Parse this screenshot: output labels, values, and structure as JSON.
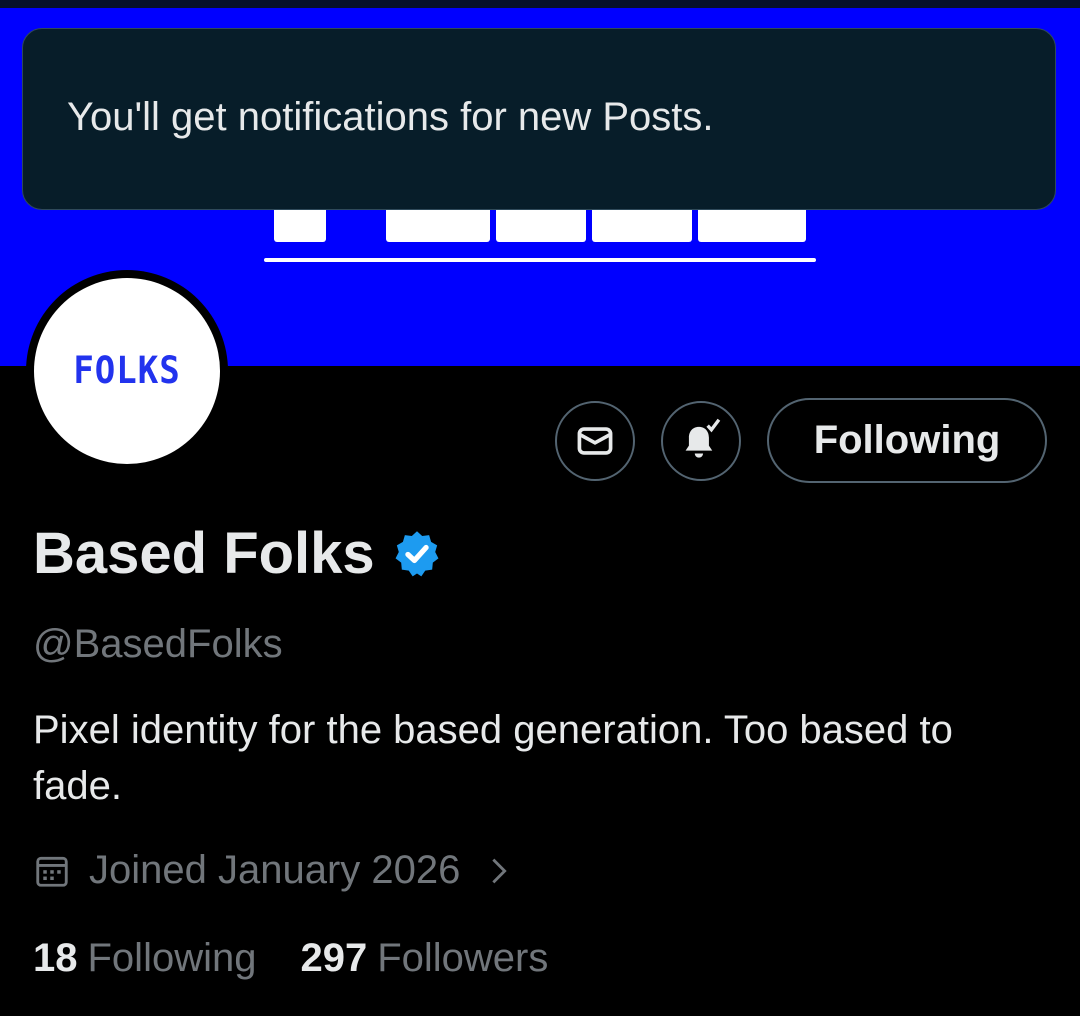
{
  "toast": {
    "message": "You'll get notifications for new Posts."
  },
  "banner": {
    "color": "#0000ff"
  },
  "avatar": {
    "logo_text": "FOLKS"
  },
  "actions": {
    "message_icon": "envelope-icon",
    "notify_icon": "bell-check-icon",
    "follow_label": "Following"
  },
  "profile": {
    "name": "Based Folks",
    "handle": "@BasedFolks",
    "bio": "Pixel identity for the based generation. Too based to fade.",
    "joined": "Joined January 2026"
  },
  "stats": {
    "following_count": "18",
    "following_label": "Following",
    "followers_count": "297",
    "followers_label": "Followers"
  },
  "colors": {
    "verified": "#1d9bf0",
    "muted": "#71767b",
    "border": "#536471"
  }
}
